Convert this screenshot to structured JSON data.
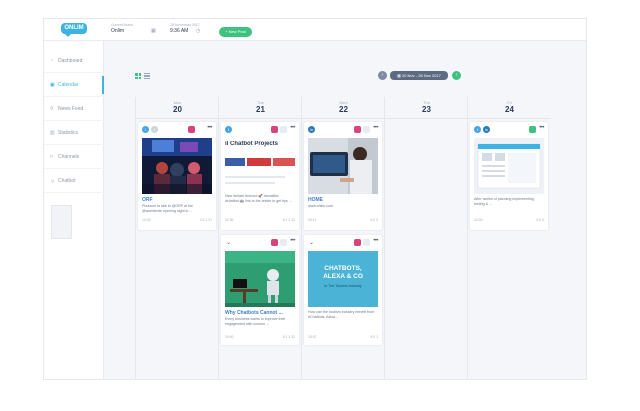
{
  "app": {
    "logo": "ONLIM",
    "brand_label": "Current Brand",
    "brand_value": "Onlim",
    "datetime_label": "25 November 2017",
    "time_value": "9:36 AM",
    "new_post_label": "+ New Post"
  },
  "sidebar": {
    "items": [
      {
        "label": "Dashboard",
        "icon": "dashboard-icon"
      },
      {
        "label": "Calendar",
        "icon": "calendar-icon"
      },
      {
        "label": "News Feed",
        "icon": "newsfeed-icon"
      },
      {
        "label": "Statistics",
        "icon": "statistics-icon"
      },
      {
        "label": "Channels",
        "icon": "channels-icon"
      },
      {
        "label": "Chatbot",
        "icon": "chatbot-icon"
      }
    ]
  },
  "toolbar": {
    "date_range": "20 Nov - 26 Nov 2017"
  },
  "days": [
    {
      "name": "Mon",
      "date": "20"
    },
    {
      "name": "Tue",
      "date": "21"
    },
    {
      "name": "Wed",
      "date": "22"
    },
    {
      "name": "Thu",
      "date": "23"
    },
    {
      "name": "Fri",
      "date": "24"
    }
  ],
  "posts": {
    "mon": {
      "title": "ORF",
      "text": "Pleasure to talk to @ORF at the @wkelderde opening night in ...",
      "time": "10:00",
      "stats": "2  6  1  37"
    },
    "tue1": {
      "headline": "il Chatbot Projects",
      "text": "New #share #record 🚀 #smallbiz #chatbot 🤖 link to the article to get tips ...",
      "time": "11:30",
      "stats": "6  1  2  12"
    },
    "tue2": {
      "title": "Why Chatbots Cannot ...",
      "text": "Every business wants to improve their engagement with custom ...",
      "time": "15:00",
      "stats": "5  1  1  32"
    },
    "wed1": {
      "title": "HOME",
      "text": "www.onlim.com",
      "time": "09:11",
      "stats": "6  0  0"
    },
    "wed2": {
      "graphic_line1": "CHATBOTS,",
      "graphic_line2": "ALEXA & CO",
      "graphic_line3": "In The Tourism Industry",
      "text": "How can the tourism industry benefit from #Chatbots, Alexa ...",
      "time": "15:57",
      "stats": "5  0  1"
    },
    "fri": {
      "text": "After weeks of planning implementing, testing & ...",
      "time": "10:00",
      "stats": "6  0  0"
    }
  },
  "colors": {
    "accent": "#3db3e3",
    "green": "#3ec27f",
    "twitter": "#42a5e8",
    "linkedin": "#2a78b5",
    "instagram": "#d8437d"
  }
}
